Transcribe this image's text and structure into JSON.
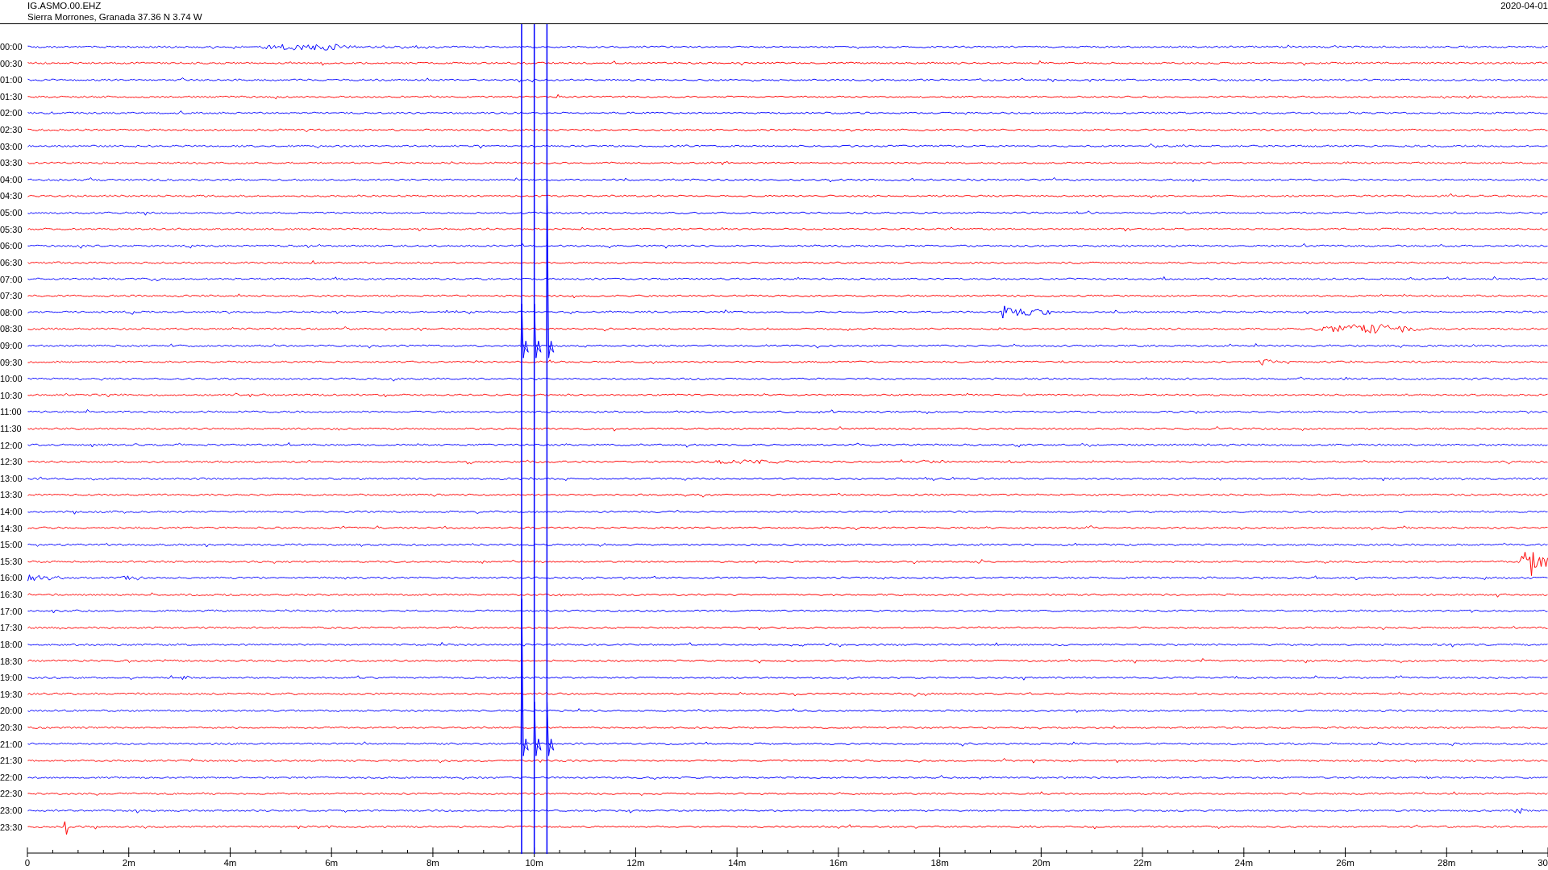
{
  "header": {
    "station": "IG.ASMO.00.EHZ",
    "location": "Sierra Morrones, Granada  37.36 N 3.74 W",
    "date": "2020-04-01"
  },
  "traces": [
    {
      "label": "00:00",
      "color": "#0000ff"
    },
    {
      "label": "00:30",
      "color": "#ff0000"
    },
    {
      "label": "01:00",
      "color": "#0000ff"
    },
    {
      "label": "01:30",
      "color": "#ff0000"
    },
    {
      "label": "02:00",
      "color": "#0000ff"
    },
    {
      "label": "02:30",
      "color": "#ff0000"
    },
    {
      "label": "03:00",
      "color": "#0000ff"
    },
    {
      "label": "03:30",
      "color": "#ff0000"
    },
    {
      "label": "04:00",
      "color": "#0000ff"
    },
    {
      "label": "04:30",
      "color": "#ff0000"
    },
    {
      "label": "05:00",
      "color": "#0000ff"
    },
    {
      "label": "05:30",
      "color": "#ff0000"
    },
    {
      "label": "06:00",
      "color": "#0000ff"
    },
    {
      "label": "06:30",
      "color": "#ff0000"
    },
    {
      "label": "07:00",
      "color": "#0000ff"
    },
    {
      "label": "07:30",
      "color": "#ff0000"
    },
    {
      "label": "08:00",
      "color": "#0000ff"
    },
    {
      "label": "08:30",
      "color": "#ff0000"
    },
    {
      "label": "09:00",
      "color": "#0000ff"
    },
    {
      "label": "09:30",
      "color": "#ff0000"
    },
    {
      "label": "10:00",
      "color": "#0000ff"
    },
    {
      "label": "10:30",
      "color": "#ff0000"
    },
    {
      "label": "11:00",
      "color": "#0000ff"
    },
    {
      "label": "11:30",
      "color": "#ff0000"
    },
    {
      "label": "12:00",
      "color": "#0000ff"
    },
    {
      "label": "12:30",
      "color": "#ff0000"
    },
    {
      "label": "13:00",
      "color": "#0000ff"
    },
    {
      "label": "13:30",
      "color": "#ff0000"
    },
    {
      "label": "14:00",
      "color": "#0000ff"
    },
    {
      "label": "14:30",
      "color": "#ff0000"
    },
    {
      "label": "15:00",
      "color": "#0000ff"
    },
    {
      "label": "15:30",
      "color": "#ff0000"
    },
    {
      "label": "16:00",
      "color": "#0000ff"
    },
    {
      "label": "16:30",
      "color": "#ff0000"
    },
    {
      "label": "17:00",
      "color": "#0000ff"
    },
    {
      "label": "17:30",
      "color": "#ff0000"
    },
    {
      "label": "18:00",
      "color": "#0000ff"
    },
    {
      "label": "18:30",
      "color": "#ff0000"
    },
    {
      "label": "19:00",
      "color": "#0000ff"
    },
    {
      "label": "19:30",
      "color": "#ff0000"
    },
    {
      "label": "20:00",
      "color": "#0000ff"
    },
    {
      "label": "20:30",
      "color": "#ff0000"
    },
    {
      "label": "21:00",
      "color": "#0000ff"
    },
    {
      "label": "21:30",
      "color": "#ff0000"
    },
    {
      "label": "22:00",
      "color": "#0000ff"
    },
    {
      "label": "22:30",
      "color": "#ff0000"
    },
    {
      "label": "23:00",
      "color": "#0000ff"
    },
    {
      "label": "23:30",
      "color": "#ff0000"
    }
  ],
  "x_axis": {
    "labels": [
      "0",
      "2m",
      "4m",
      "6m",
      "8m",
      "10m",
      "12m",
      "14m",
      "16m",
      "18m",
      "20m",
      "22m",
      "24m",
      "26m",
      "28m",
      "30"
    ]
  }
}
